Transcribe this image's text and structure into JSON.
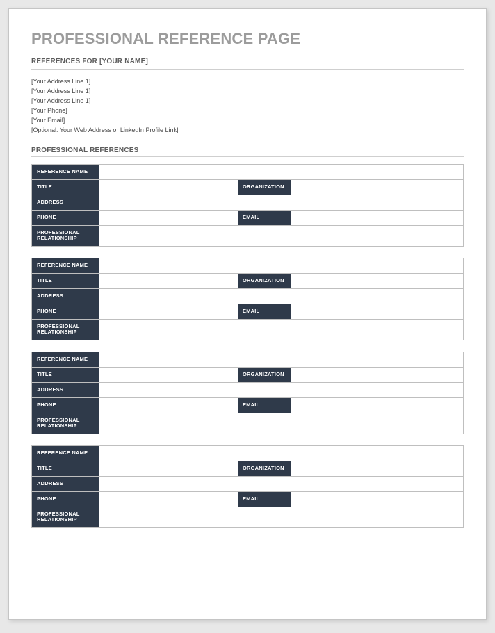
{
  "title": "PROFESSIONAL REFERENCE PAGE",
  "subheading": "REFERENCES FOR [YOUR NAME]",
  "info_lines": [
    "[Your Address Line 1]",
    "[Your Address Line 1]",
    "[Your Address Line 1]",
    "[Your Phone]",
    "[Your Email]",
    "[Optional: Your Web Address or LinkedIn Profile Link]"
  ],
  "section_heading": "PROFESSIONAL REFERENCES",
  "labels": {
    "reference_name": "REFERENCE NAME",
    "title": "TITLE",
    "organization": "ORGANIZATION",
    "address": "ADDRESS",
    "phone": "PHONE",
    "email": "EMAIL",
    "relationship": "PROFESSIONAL RELATIONSHIP"
  },
  "references": [
    {
      "name": "",
      "title": "",
      "organization": "",
      "address": "",
      "phone": "",
      "email": "",
      "relationship": ""
    },
    {
      "name": "",
      "title": "",
      "organization": "",
      "address": "",
      "phone": "",
      "email": "",
      "relationship": ""
    },
    {
      "name": "",
      "title": "",
      "organization": "",
      "address": "",
      "phone": "",
      "email": "",
      "relationship": ""
    },
    {
      "name": "",
      "title": "",
      "organization": "",
      "address": "",
      "phone": "",
      "email": "",
      "relationship": ""
    }
  ]
}
